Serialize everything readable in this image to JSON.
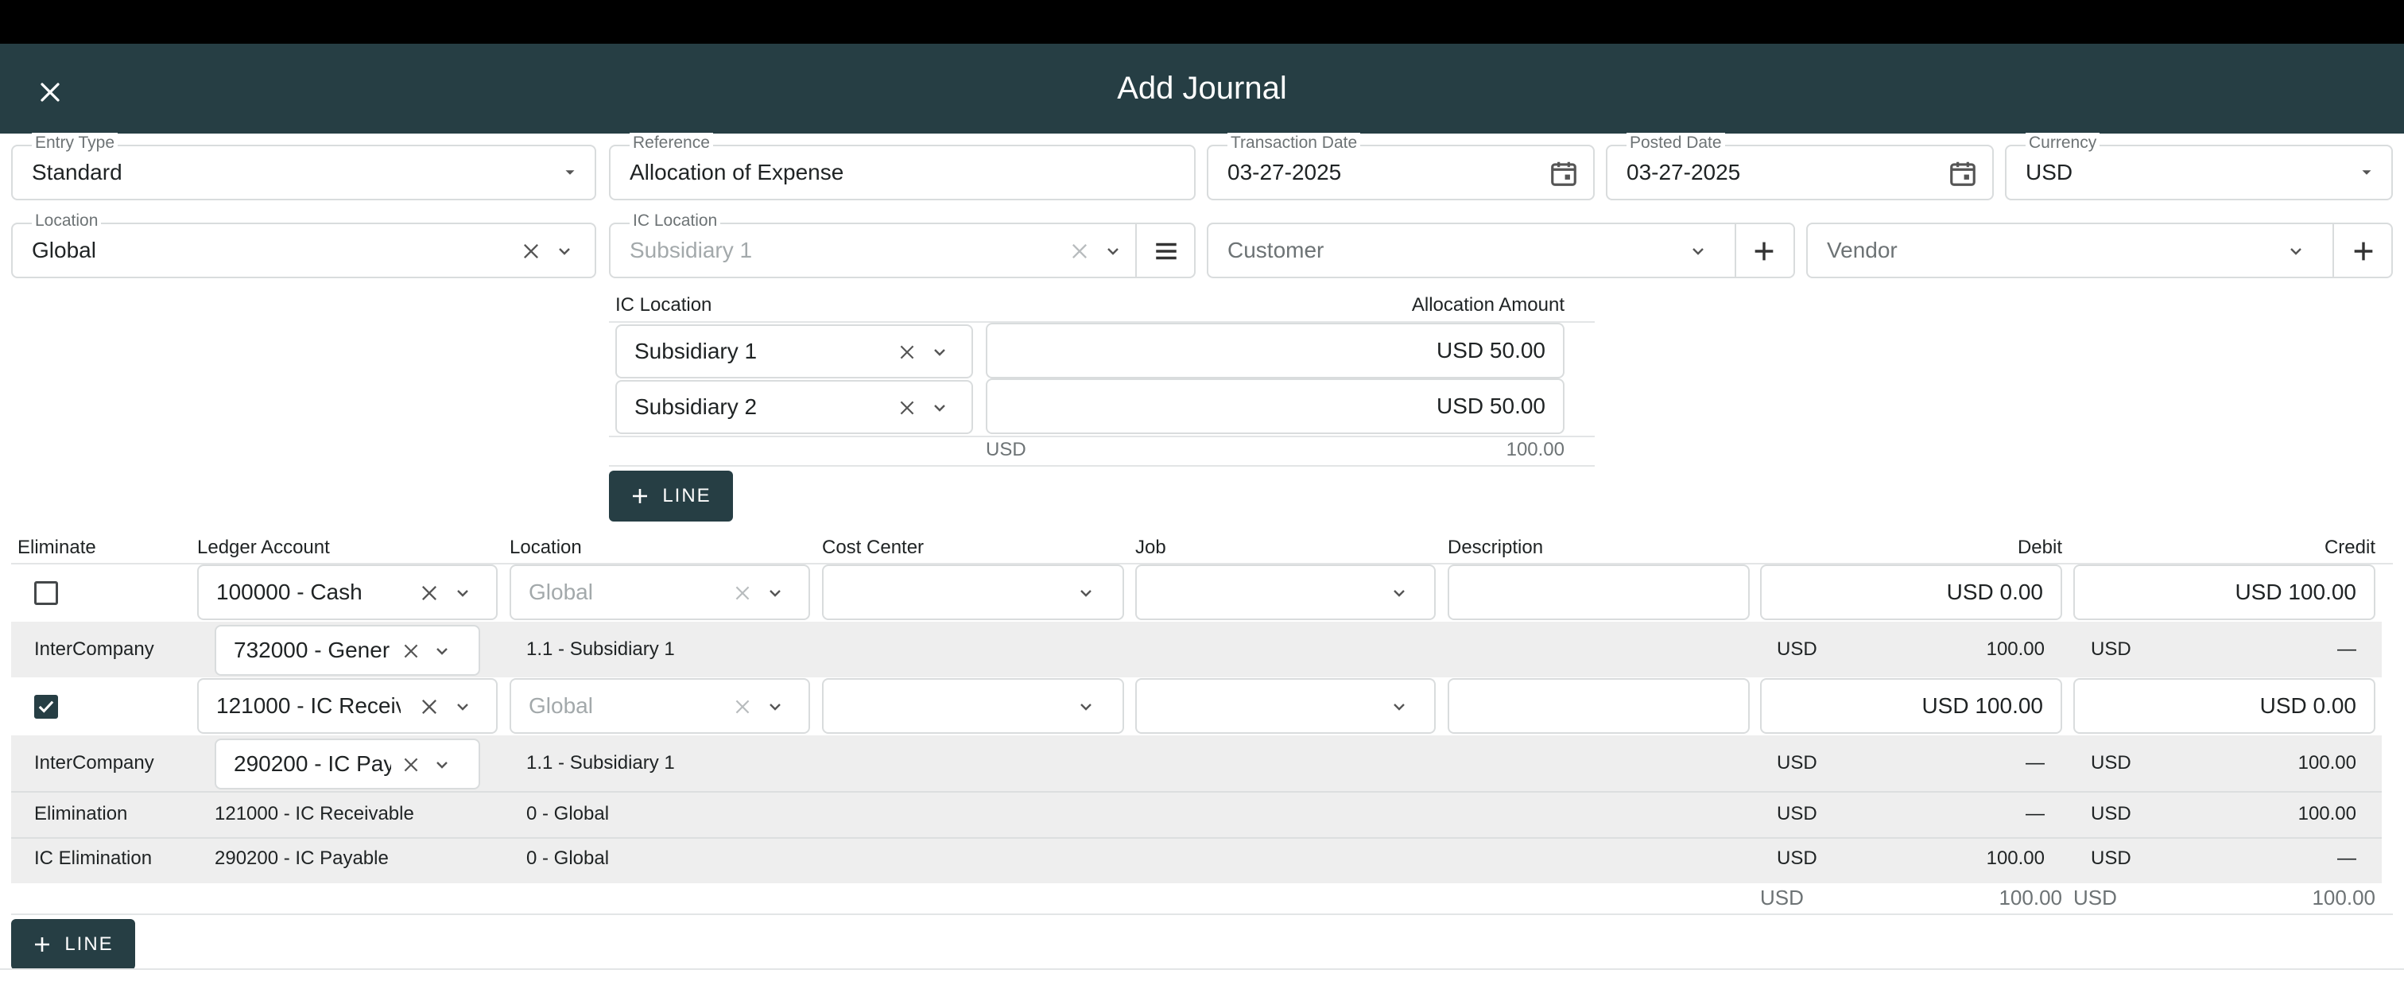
{
  "dialog": {
    "title": "Add Journal"
  },
  "header": {
    "entry_type": {
      "label": "Entry Type",
      "value": "Standard"
    },
    "reference": {
      "label": "Reference",
      "value": "Allocation of Expense"
    },
    "transaction_date": {
      "label": "Transaction Date",
      "value": "03-27-2025"
    },
    "posted_date": {
      "label": "Posted Date",
      "value": "03-27-2025"
    },
    "currency": {
      "label": "Currency",
      "value": "USD"
    },
    "location": {
      "label": "Location",
      "value": "Global"
    },
    "ic_location": {
      "label": "IC Location",
      "placeholder": "Subsidiary 1"
    },
    "customer": {
      "placeholder": "Customer"
    },
    "vendor": {
      "placeholder": "Vendor"
    }
  },
  "allocation": {
    "col_ic_location": "IC Location",
    "col_amount": "Allocation Amount",
    "rows": [
      {
        "location": "Subsidiary 1",
        "amount": "USD 50.00"
      },
      {
        "location": "Subsidiary 2",
        "amount": "USD 50.00"
      }
    ],
    "total_currency": "USD",
    "total_amount": "100.00",
    "add_line_label": "LINE"
  },
  "lines": {
    "columns": {
      "eliminate": "Eliminate",
      "ledger_account": "Ledger Account",
      "location": "Location",
      "cost_center": "Cost Center",
      "job": "Job",
      "description": "Description",
      "debit": "Debit",
      "credit": "Credit"
    },
    "entries": [
      {
        "eliminate": false,
        "account": "100000 - Cash",
        "location_placeholder": "Global",
        "debit": "USD 0.00",
        "credit": "USD 100.00",
        "sub_rows": [
          {
            "type": "InterCompany",
            "account": "732000 - Gener",
            "location": "1.1 - Subsidiary 1",
            "debit_cur": "USD",
            "debit": "100.00",
            "credit_cur": "USD",
            "credit": "—"
          }
        ]
      },
      {
        "eliminate": true,
        "account": "121000 - IC Receiv",
        "location_placeholder": "Global",
        "debit": "USD 100.00",
        "credit": "USD 0.00",
        "sub_rows": [
          {
            "type": "InterCompany",
            "account": "290200 - IC Pay",
            "location": "1.1 - Subsidiary 1",
            "debit_cur": "USD",
            "debit": "—",
            "credit_cur": "USD",
            "credit": "100.00"
          },
          {
            "type": "Elimination",
            "account": "121000 - IC Receivable",
            "location": "0 - Global",
            "debit_cur": "USD",
            "debit": "—",
            "credit_cur": "USD",
            "credit": "100.00"
          },
          {
            "type": "IC Elimination",
            "account": "290200 - IC Payable",
            "location": "0 - Global",
            "debit_cur": "USD",
            "debit": "100.00",
            "credit_cur": "USD",
            "credit": "—"
          }
        ]
      }
    ],
    "totals": {
      "debit_cur": "USD",
      "debit": "100.00",
      "credit_cur": "USD",
      "credit": "100.00"
    },
    "add_line_label": "LINE"
  }
}
